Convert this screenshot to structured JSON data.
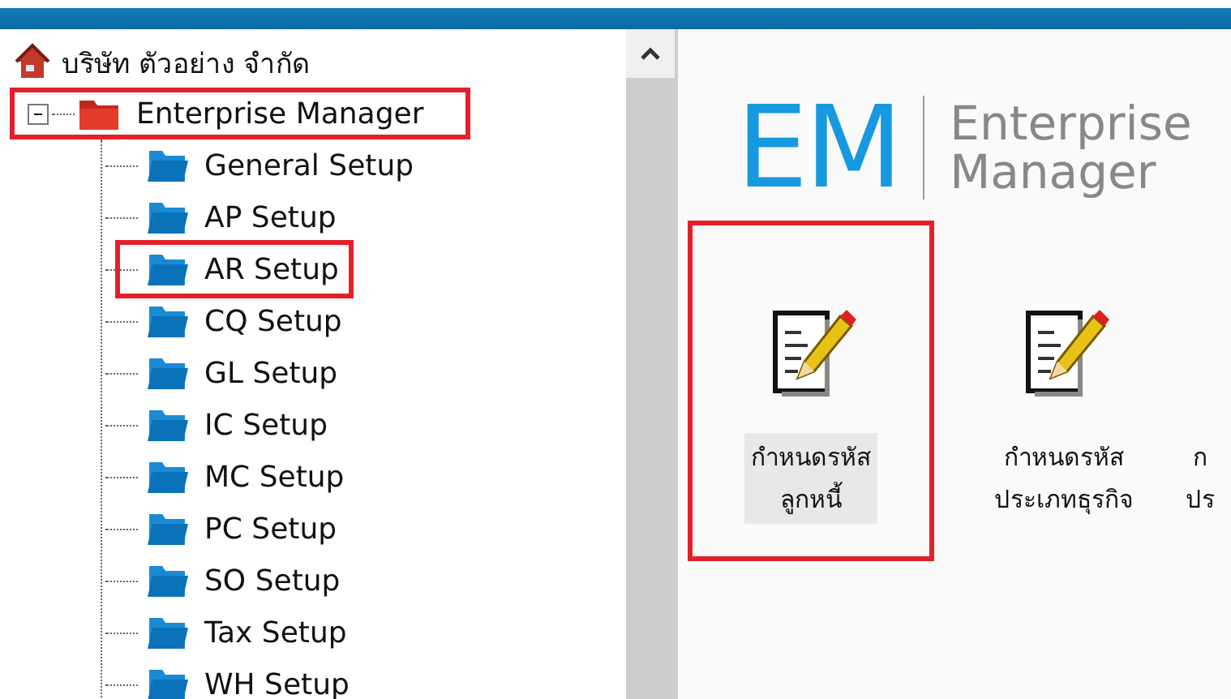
{
  "tree": {
    "root": {
      "label": "บริษัท ตัวอย่าง จำกัด",
      "children": [
        {
          "label": "Enterprise Manager",
          "expanded": true,
          "highlighted": true,
          "children": [
            {
              "label": "General Setup",
              "highlighted": false
            },
            {
              "label": "AP Setup",
              "highlighted": false
            },
            {
              "label": "AR Setup",
              "highlighted": true
            },
            {
              "label": "CQ Setup",
              "highlighted": false
            },
            {
              "label": "GL Setup",
              "highlighted": false
            },
            {
              "label": "IC Setup",
              "highlighted": false
            },
            {
              "label": "MC Setup",
              "highlighted": false
            },
            {
              "label": "PC Setup",
              "highlighted": false
            },
            {
              "label": "SO Setup",
              "highlighted": false
            },
            {
              "label": "Tax Setup",
              "highlighted": false
            },
            {
              "label": "WH Setup",
              "highlighted": false
            }
          ]
        }
      ]
    }
  },
  "logo": {
    "initials": "EM",
    "line_1": "Enterprise",
    "line_2": "Manager"
  },
  "tiles": [
    {
      "lines": [
        "กำหนดรหัส",
        "ลูกหนี้"
      ],
      "selected": true,
      "highlighted": true,
      "icon": true
    },
    {
      "lines": [
        "กำหนดรหัส",
        "ประเภทธุรกิจ"
      ],
      "selected": false,
      "highlighted": false,
      "icon": true
    },
    {
      "lines": [
        "ก",
        "ปร"
      ],
      "selected": false,
      "highlighted": false,
      "icon": false
    }
  ]
}
